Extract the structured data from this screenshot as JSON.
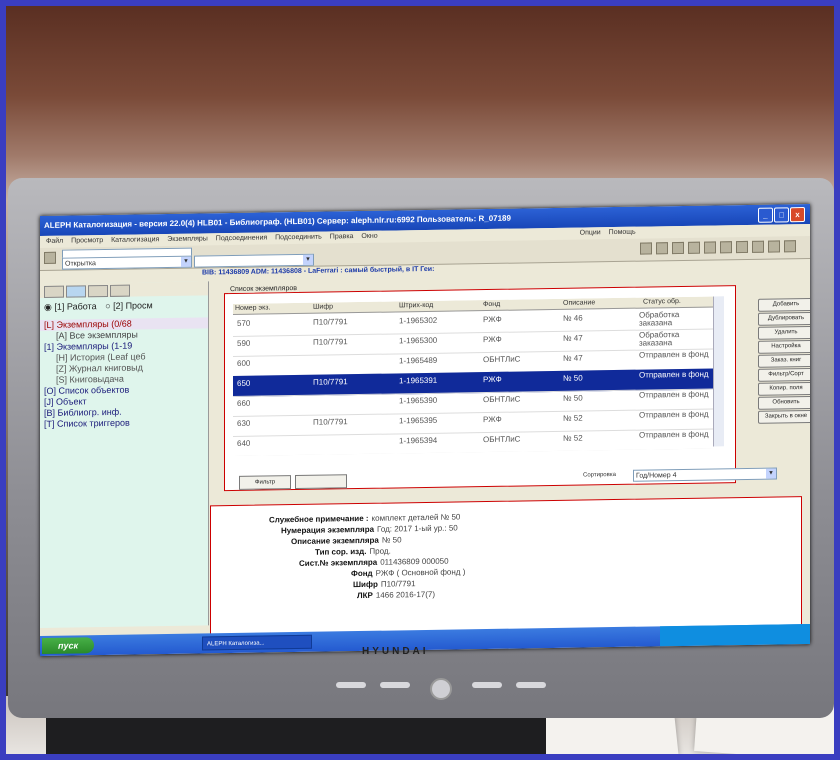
{
  "window": {
    "title": "ALEPH Каталогизация - версия 22.0(4) HLB01 - Библиограф. (HLB01) Сервер: aleph.nlr.ru:6992 Пользователь: R_07189",
    "minimize": "_",
    "maximize": "□",
    "close": "x"
  },
  "menu": [
    "Файл",
    "Просмотр",
    "Каталогизация",
    "Экземпляры",
    "Подсоединения",
    "Подсоединить",
    "Правка",
    "Окно",
    "Опции",
    "Помощь"
  ],
  "toolbar": {
    "combo1": "",
    "combo2": "Открытка",
    "combo3": ""
  },
  "record_bar": "BIB: 11436809 ADM: 11436808 - LaFerrari : самый быстрый, в IT Геи:",
  "left": {
    "radio_work": "[1] Работа",
    "radio_prev": "[2] Просм",
    "tree": [
      "[L] Экземпляры (0/68",
      "[A] Все экземпляры",
      "[1] Экземпляры (1-19",
      "[H] История (Leaf цеб",
      "[Z] Журнал книговыд",
      "[S] Книговыдача",
      "[O] Список объектов",
      "[J] Объект",
      "[B] Библиогр. инф.",
      "[T] Список триггеров"
    ]
  },
  "items_list": {
    "label": "Список экземпляров",
    "columns": [
      "Номер экз.",
      "Шифр",
      "Штрих-код",
      "Фонд",
      "Описание",
      "Статус обр."
    ],
    "rows": [
      {
        "num": "570",
        "shelf": "П10/7791",
        "barcode": "1-1965302",
        "fund": "РЖФ",
        "desc": "№ 46",
        "status": "Обработка заказана",
        "selected": false
      },
      {
        "num": "590",
        "shelf": "П10/7791",
        "barcode": "1-1965300",
        "fund": "РЖФ",
        "desc": "№ 47",
        "status": "Обработка заказана",
        "selected": false
      },
      {
        "num": "600",
        "shelf": "",
        "barcode": "1-1965489",
        "fund": "ОБНТЛиС",
        "desc": "№ 47",
        "status": "Отправлен в фонд",
        "selected": false
      },
      {
        "num": "650",
        "shelf": "П10/7791",
        "barcode": "1-1965391",
        "fund": "РЖФ",
        "desc": "№ 50",
        "status": "Отправлен в фонд",
        "selected": true
      },
      {
        "num": "660",
        "shelf": "",
        "barcode": "1-1965390",
        "fund": "ОБНТЛиС",
        "desc": "№ 50",
        "status": "Отправлен в фонд",
        "selected": false
      },
      {
        "num": "630",
        "shelf": "П10/7791",
        "barcode": "1-1965395",
        "fund": "РЖФ",
        "desc": "№ 52",
        "status": "Отправлен в фонд",
        "selected": false
      },
      {
        "num": "640",
        "shelf": "",
        "barcode": "1-1965394",
        "fund": "ОБНТЛиС",
        "desc": "№ 52",
        "status": "Отправлен в фонд",
        "selected": false
      }
    ],
    "buttons": [
      "Добавить",
      "Дублировать",
      "Удалить",
      "Настройка",
      "Заказ. книг",
      "Фильтр/Сорт",
      "Копир. поля",
      "Обновить",
      "Закрыть в окне"
    ],
    "bottom_buttons": [
      "Фильтр",
      ""
    ],
    "sort_label": "Сортировка",
    "sort_value": "Год/Номер 4"
  },
  "detail": {
    "lines": [
      {
        "label": "Служебное примечание :",
        "value": "комплект деталей № 50"
      },
      {
        "label": "Нумерация экземпляра",
        "value": "Год: 2017  1-ый ур.: 50"
      },
      {
        "label": "Описание экземпляра",
        "value": "№ 50"
      },
      {
        "label": "Тип сор. изд.",
        "value": "Прод."
      },
      {
        "label": "Сист.№ экземпляра",
        "value": "011436809 000050"
      },
      {
        "label": "Фонд",
        "value": "РЖФ ( Основной фонд )"
      },
      {
        "label": "Шифр",
        "value": "П10/7791"
      },
      {
        "label": "ЛКР",
        "value": "1466 2016-17(7)"
      }
    ]
  },
  "taskbar": {
    "start": "пуск",
    "task": "ALEPH Каталогиза..."
  },
  "monitor_brand": "HYUNDAI",
  "colors": {
    "selection": "#102a9a",
    "titlebar": "#1846b8",
    "left_panel": "#dff5ec"
  }
}
